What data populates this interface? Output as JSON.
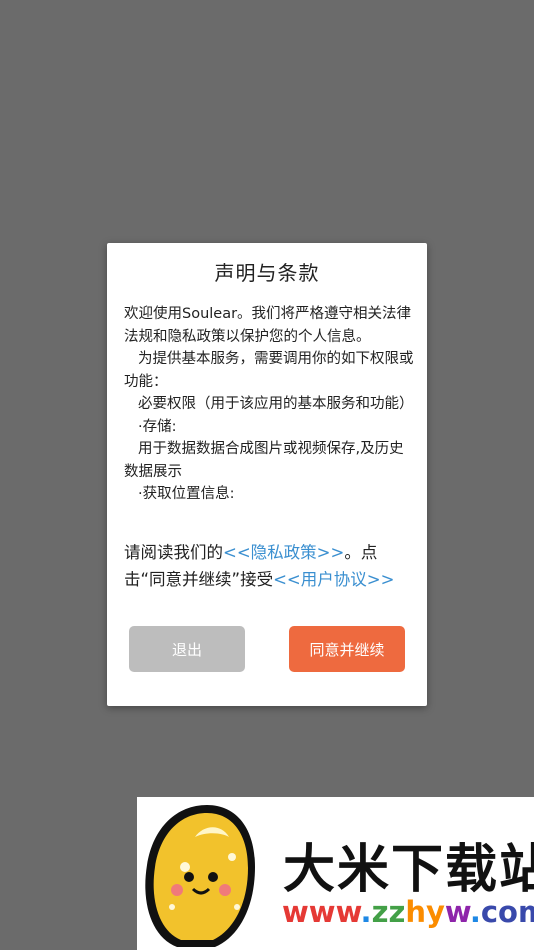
{
  "dialog": {
    "title": "声明与条款",
    "terms": [
      "欢迎使用Soulear。我们将严格遵守相关法律法规和隐私政策以保护您的个人信息。",
      "为提供基本服务，需要调用你的如下权限或功能：",
      "必要权限（用于该应用的基本服务和功能）",
      "·存储:",
      "用于数据数据合成图片或视频保存,及历史数据展示",
      "·获取位置信息:"
    ],
    "notice_prefix": "请阅读我们的",
    "privacy_link": "<<隐私政策>>",
    "notice_middle": "。点击“同意并继续”接受",
    "agreement_link": "<<用户协议>>",
    "exit_label": "退出",
    "agree_label": "同意并继续"
  },
  "watermark": {
    "name": "大米下载站",
    "url_parts": [
      "www",
      ".",
      "zz",
      "hy",
      "w",
      ".",
      "com"
    ],
    "url_colors": [
      "#e53935",
      "#1e88e5",
      "#43a047",
      "#fb8c00",
      "#8e24aa",
      "#1e88e5",
      "#3949ab"
    ]
  },
  "colors": {
    "overlay": "#6b6b6b",
    "link": "#3a8fd0",
    "agree_button": "#ee6a3f",
    "exit_button": "#bdbdbd"
  }
}
